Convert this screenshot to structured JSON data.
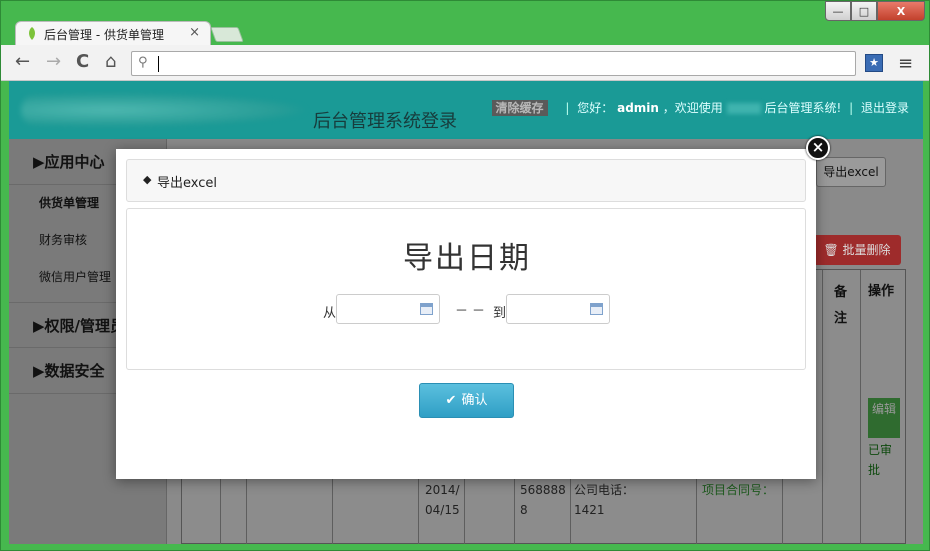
{
  "browser": {
    "tab_title": "后台管理 - 供货单管理",
    "tab_close": "×",
    "win_min": "—",
    "win_max": "□",
    "win_close": "X",
    "back": "←",
    "forward": "→",
    "reload": "C",
    "home": "⌂",
    "search_glyph": "⚲",
    "address_value": "",
    "ext_glyph": "★",
    "menu_glyph": "≡"
  },
  "header": {
    "site_title": "后台管理系统登录",
    "clear_cache": "清除缓存",
    "greeting_prefix": "您好：",
    "username": "admin",
    "greeting_mid": "，欢迎使用",
    "greeting_suffix": "后台管理系统!",
    "logout": "退出登录"
  },
  "sidebar": {
    "groups": [
      {
        "label": "应用中心"
      },
      {
        "label": "权限/管理员"
      },
      {
        "label": "数据安全"
      }
    ],
    "items": [
      {
        "label": "供货单管理"
      },
      {
        "label": "财务审核"
      },
      {
        "label": "微信用户管理"
      }
    ]
  },
  "content": {
    "export_button": "导出excel",
    "batch_delete": "批量删除",
    "col_remark": "备注",
    "col_ops": "操作",
    "edit_button": "编辑",
    "status": "已审批",
    "cell_date": "2014/04/15",
    "cell_phone": "5688888",
    "cell_company": "公司电话：1421",
    "cell_contract": "项目合同号："
  },
  "modal": {
    "header_title": "导出excel",
    "title": "导出日期",
    "from_label": "从",
    "separator": "－－",
    "to_label": "到",
    "from_value": "",
    "to_value": "",
    "confirm": "确认",
    "close_glyph": "×"
  }
}
